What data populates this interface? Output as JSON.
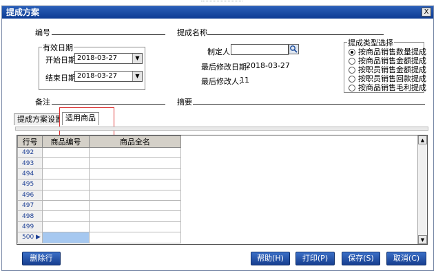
{
  "window": {
    "title": "提成方案",
    "close_label": "X"
  },
  "form": {
    "code_label": "编号",
    "name_label": "提成名称",
    "valid_date": {
      "title": "有效日期",
      "start_label": "开始日期",
      "start_value": "2018-03-27",
      "end_label": "结束日期",
      "end_value": "2018-03-27"
    },
    "creator_label": "制定人",
    "last_modified_date_label": "最后修改日期:",
    "last_modified_date_value": "2018-03-27",
    "last_modified_by_label": "最后修改人:",
    "last_modified_by_value": "11",
    "remark_label": "备注",
    "summary_label": "摘要",
    "type_group": {
      "title": "提成类型选择",
      "options": [
        {
          "label": "按商品销售数量提成",
          "selected": true
        },
        {
          "label": "按商品销售金额提成",
          "selected": false
        },
        {
          "label": "按职员销售金额提成",
          "selected": false
        },
        {
          "label": "按职员销售回款提成",
          "selected": false
        },
        {
          "label": "按商品销售毛利提成",
          "selected": false
        }
      ]
    }
  },
  "tabs": [
    {
      "label": "提成方案设置"
    },
    {
      "label": "适用商品"
    }
  ],
  "grid": {
    "columns": [
      "行号",
      "商品编号",
      "商品全名"
    ],
    "rows": [
      "492",
      "493",
      "494",
      "495",
      "496",
      "497",
      "498",
      "499",
      "500"
    ]
  },
  "buttons": {
    "delete_row": "删除行",
    "help": "帮助(H)",
    "print": "打印(P)",
    "save": "保存(S)",
    "cancel": "取消(C)"
  }
}
